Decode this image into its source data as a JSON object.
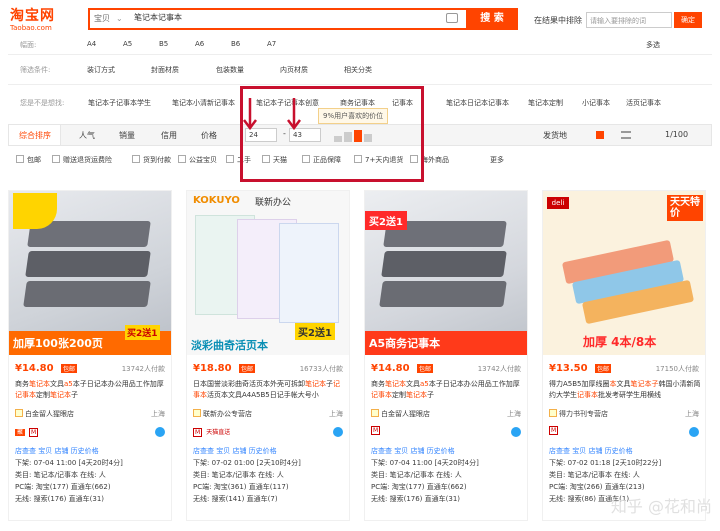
{
  "header": {
    "logo_cn": "淘宝网",
    "logo_en": "Taobao.com",
    "search_type": "宝贝",
    "search_query": "笔记本记事本",
    "search_button": "搜 索",
    "insearch_label": "在结果中排除",
    "insearch_placeholder": "请输入要排除的词",
    "insearch_button": "确定"
  },
  "filters": {
    "size_label": "幅面:",
    "sizes": [
      "A4",
      "A5",
      "B5",
      "A6",
      "B6",
      "A7"
    ],
    "multi": "多选",
    "cond_label": "筛选条件:",
    "conds": [
      "装订方式",
      "封面材质",
      "包装数量",
      "内页材质",
      "相关分类"
    ],
    "suggest_label": "您是不是想找:",
    "suggests": [
      "笔记本子记事本学生",
      "笔记本小清新记事本",
      "笔记本子记事本创意",
      "商务记事本",
      "记事本",
      "笔记本日记本记事本",
      "笔记本定制",
      "小记事本",
      "活页记事本"
    ]
  },
  "sortbar": {
    "items": [
      "综合排序",
      "人气",
      "销量",
      "信用",
      "价格"
    ],
    "price_min": "24",
    "price_max": "43",
    "tooltip": "9%用户喜欢的价位",
    "ship_from": "发货地",
    "page": "1/100"
  },
  "checks": [
    "包邮",
    "赠送退货运费险",
    "货到付款",
    "公益宝贝",
    "二手",
    "天猫",
    "正品保障",
    "7+天内退货",
    "海外商品",
    "更多"
  ],
  "cards": [
    {
      "price": "¥14.80",
      "tag": "包邮",
      "paid": "13742人付款",
      "title_pre": "商务",
      "title_hl1": "笔记本",
      "title_mid": "文具",
      "title_hl2": "a5",
      "title_post": "本子日记本办公用品工作加厚",
      "title_hl3": "记事本",
      "title_post2": "定制",
      "title_hl4": "笔记本",
      "title_end": "子",
      "shop": "白金留人猩眼店",
      "loc": "上海",
      "img_text": "加厚100张200页",
      "img_sub": "买2送1",
      "plugin": [
        "店查查 宝贝 店铺 历史价格",
        "下架: 07-04 11:00 [4天20时4分]",
        "类目: 笔记本/记事本 在线: 人",
        "PC端: 淘宝(177) 直通车(662)",
        "无线: 搜索(176) 直通车(31)"
      ]
    },
    {
      "price": "¥18.80",
      "tag": "包邮",
      "paid": "16733人付款",
      "title_pre": "日本国誉淡彩曲奇活页本外壳可拆卸",
      "title_hl1": "笔记本",
      "title_mid": "子",
      "title_hl2": "记事本",
      "title_post": "活页本文具A4A5B5日记手帐大号小",
      "title_hl3": "",
      "title_post2": "",
      "title_hl4": "",
      "title_end": "",
      "shop": "联新办公专营店",
      "loc": "上海",
      "img_text": "淡彩曲奇活页本",
      "img_sub": "买2送1",
      "plugin": [
        "店查查 宝贝 店铺 历史价格",
        "下架: 07-02 01:00 [2天10时4分]",
        "类目: 笔记本/记事本 在线: 人",
        "PC端: 淘宝(361) 直通车(117)",
        "无线: 搜索(141) 直通车(7)"
      ]
    },
    {
      "price": "¥14.80",
      "tag": "包邮",
      "paid": "13742人付款",
      "title_pre": "商务",
      "title_hl1": "笔记本",
      "title_mid": "文具",
      "title_hl2": "a5",
      "title_post": "本子日记本办公用品工作加厚",
      "title_hl3": "记事本",
      "title_post2": "定制",
      "title_hl4": "笔记本",
      "title_end": "子",
      "shop": "白金留人猩眼店",
      "loc": "上海",
      "img_text": "A5商务记事本",
      "img_sub": "买2送1",
      "plugin": [
        "店查查 宝贝 店铺 历史价格",
        "下架: 07-04 11:00 [4天20时4分]",
        "类目: 笔记本/记事本 在线: 人",
        "PC端: 淘宝(177) 直通车(662)",
        "无线: 搜索(176) 直通车(31)"
      ]
    },
    {
      "price": "¥13.50",
      "tag": "包邮",
      "paid": "17150人付款",
      "title_pre": "得力A5B5加厚线圈",
      "title_hl1": "本",
      "title_mid": "文具",
      "title_hl2": "笔记本子",
      "title_post": "韩国小清新简约大学生",
      "title_hl3": "记事本",
      "title_post2": "批发考研学生用横线",
      "title_hl4": "",
      "title_end": "",
      "shop": "得力书刊专营店",
      "loc": "上海",
      "img_text": "加厚 4本/8本",
      "img_sub": "天天特价",
      "plugin": [
        "店查查 宝贝 店铺 历史价格",
        "下架: 07-02 01:18 [2天10时22分]",
        "类目: 笔记本/记事本 在线: 人",
        "PC端: 淘宝(266) 直通车(213)",
        "无线: 搜索(86) 直通车(1)"
      ]
    }
  ],
  "watermark": "知乎 @花和尚",
  "colors": {
    "accent": "#ff4400",
    "highlight": "#c8102e",
    "link": "#3385ff"
  }
}
